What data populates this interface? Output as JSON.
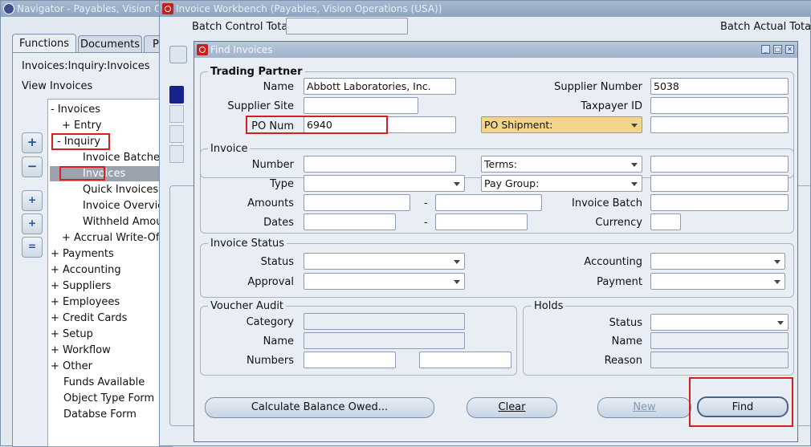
{
  "navigator": {
    "title": "Navigator - Payables, Vision Operations (USA)",
    "tabs": [
      "Functions",
      "Documents",
      "P"
    ],
    "path": "Invoices:Inquiry:Invoices",
    "subtitle": "View Invoices",
    "tree": [
      {
        "label": "- Invoices"
      },
      {
        "label": "+ Entry"
      },
      {
        "label": "- Inquiry"
      },
      {
        "label": "Invoice Batches"
      },
      {
        "label": "Invoices"
      },
      {
        "label": "Quick Invoices"
      },
      {
        "label": "Invoice Overview"
      },
      {
        "label": "Withheld Amount"
      },
      {
        "label": "+ Accrual Write-Off"
      },
      {
        "label": "+ Payments"
      },
      {
        "label": "+ Accounting"
      },
      {
        "label": "+ Suppliers"
      },
      {
        "label": "+ Employees"
      },
      {
        "label": "+ Credit Cards"
      },
      {
        "label": "+ Setup"
      },
      {
        "label": "+ Workflow"
      },
      {
        "label": "+ Other"
      },
      {
        "label": "Funds Available"
      },
      {
        "label": "Object Type Form"
      },
      {
        "label": "Databse Form"
      }
    ]
  },
  "workbench": {
    "title": "Invoice Workbench (Payables, Vision Operations (USA))",
    "batch_control_total": "Batch Control Total",
    "batch_actual_total": "Batch Actual Total"
  },
  "find": {
    "title": "Find Invoices",
    "trading_partner": {
      "heading": "Trading Partner",
      "name_label": "Name",
      "name_value": "Abbott Laboratories, Inc.",
      "supplier_number_label": "Supplier Number",
      "supplier_number_value": "5038",
      "supplier_site_label": "Supplier Site",
      "taxpayer_id_label": "Taxpayer ID",
      "po_num_label": "PO Num",
      "po_num_value": "6940",
      "po_shipment_value": "PO Shipment:"
    },
    "invoice": {
      "heading": "Invoice",
      "number_label": "Number",
      "terms_value": "Terms:",
      "type_label": "Type",
      "pay_group_value": "Pay Group:",
      "amounts_label": "Amounts",
      "invoice_batch_label": "Invoice Batch",
      "dates_label": "Dates",
      "currency_label": "Currency",
      "dash": "-"
    },
    "invoice_status": {
      "heading": "Invoice Status",
      "status_label": "Status",
      "accounting_label": "Accounting",
      "approval_label": "Approval",
      "payment_label": "Payment"
    },
    "voucher_audit": {
      "heading": "Voucher Audit",
      "category_label": "Category",
      "name_label": "Name",
      "numbers_label": "Numbers"
    },
    "holds": {
      "heading": "Holds",
      "status_label": "Status",
      "name_label": "Name",
      "reason_label": "Reason"
    },
    "buttons": {
      "calculate": "Calculate Balance Owed...",
      "clear": "Clear",
      "new": "New",
      "find": "Find"
    }
  },
  "colors": {
    "highlight": "#d62020",
    "required_field": "#f2d58c",
    "selected_tree": "#9aa3ad"
  }
}
